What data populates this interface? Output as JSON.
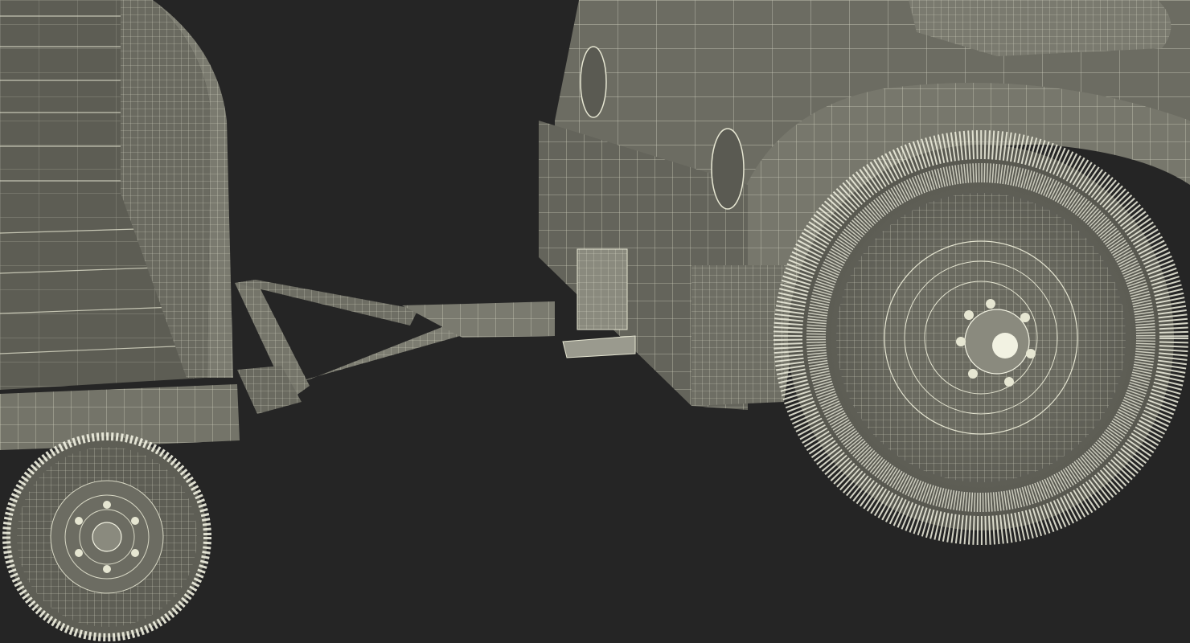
{
  "scene": {
    "subject": "wireframe-render",
    "colors": {
      "background": "#252525",
      "surface": "#6e6e64",
      "surface_dark": "#55554c",
      "surface_light": "#8a8a7e",
      "wire": "#e6e6d2",
      "wire_dense": "#f2f2e2"
    }
  }
}
